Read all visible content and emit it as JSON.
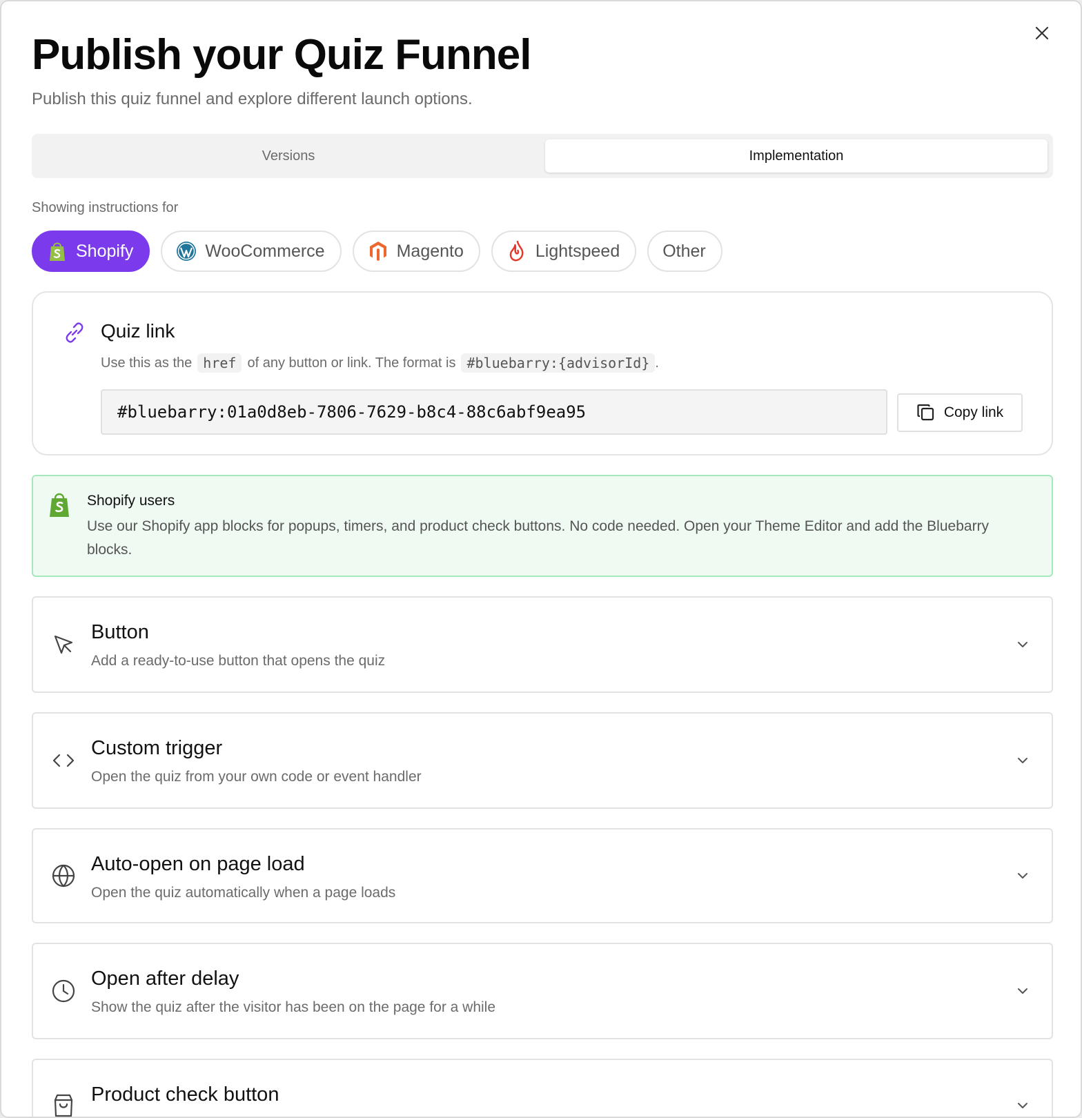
{
  "modal": {
    "title": "Publish your Quiz Funnel",
    "subtitle": "Publish this quiz funnel and explore different launch options."
  },
  "tabs": [
    {
      "label": "Versions",
      "active": false
    },
    {
      "label": "Implementation",
      "active": true
    }
  ],
  "instructions_label": "Showing instructions for",
  "platforms": [
    {
      "label": "Shopify",
      "icon": "shopify-icon",
      "active": true
    },
    {
      "label": "WooCommerce",
      "icon": "wordpress-icon",
      "active": false
    },
    {
      "label": "Magento",
      "icon": "magento-icon",
      "active": false
    },
    {
      "label": "Lightspeed",
      "icon": "lightspeed-icon",
      "active": false
    },
    {
      "label": "Other",
      "icon": "",
      "active": false
    }
  ],
  "quiz_link": {
    "title": "Quiz link",
    "desc_prefix": "Use this as the",
    "desc_code1": "href",
    "desc_middle": "of any button or link. The format is",
    "desc_code2": "#bluebarry:{advisorId}",
    "desc_suffix": ".",
    "value": "#bluebarry:01a0d8eb-7806-7629-b8c4-88c6abf9ea95",
    "copy_label": "Copy link"
  },
  "shopify_notice": {
    "title": "Shopify users",
    "body": "Use our Shopify app blocks for popups, timers, and product check buttons. No code needed. Open your Theme Editor and add the Bluebarry blocks."
  },
  "options": [
    {
      "title": "Button",
      "desc": "Add a ready-to-use button that opens the quiz",
      "icon": "cursor-icon"
    },
    {
      "title": "Custom trigger",
      "desc": "Open the quiz from your own code or event handler",
      "icon": "code-icon"
    },
    {
      "title": "Auto-open on page load",
      "desc": "Open the quiz automatically when a page loads",
      "icon": "globe-icon"
    },
    {
      "title": "Open after delay",
      "desc": "Show the quiz after the visitor has been on the page for a while",
      "icon": "clock-icon"
    },
    {
      "title": "Product check button",
      "desc": "",
      "icon": "shopping-bag-icon"
    }
  ],
  "colors": {
    "accent": "#7c3aed",
    "notice_bg": "#effaf3",
    "notice_border": "#a6e8bd",
    "shopify_green": "#5fa833"
  }
}
